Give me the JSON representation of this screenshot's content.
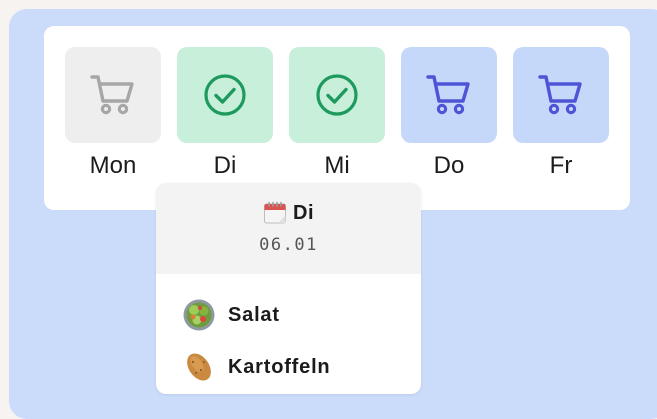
{
  "days": [
    {
      "label": "Mon",
      "state": "neutral",
      "icon": "cart-icon"
    },
    {
      "label": "Di",
      "state": "done",
      "icon": "check-circle-icon"
    },
    {
      "label": "Mi",
      "state": "done",
      "icon": "check-circle-icon"
    },
    {
      "label": "Do",
      "state": "shop",
      "icon": "cart-icon"
    },
    {
      "label": "Fr",
      "state": "shop",
      "icon": "cart-icon"
    }
  ],
  "popup": {
    "title": "Di",
    "title_icon": "calendar-icon",
    "date": "06.01",
    "meals": [
      {
        "name": "Salat",
        "icon": "salad-icon"
      },
      {
        "name": "Kartoffeln",
        "icon": "potato-icon"
      }
    ]
  },
  "colors": {
    "background": "#cbdcfb",
    "neutral_tile": "#eeeeee",
    "neutral_icon": "#a6a6a6",
    "done_tile": "#c7efd9",
    "done_icon": "#1f9a5f",
    "shop_tile": "#c6d8fa",
    "shop_icon": "#4d55d6"
  }
}
